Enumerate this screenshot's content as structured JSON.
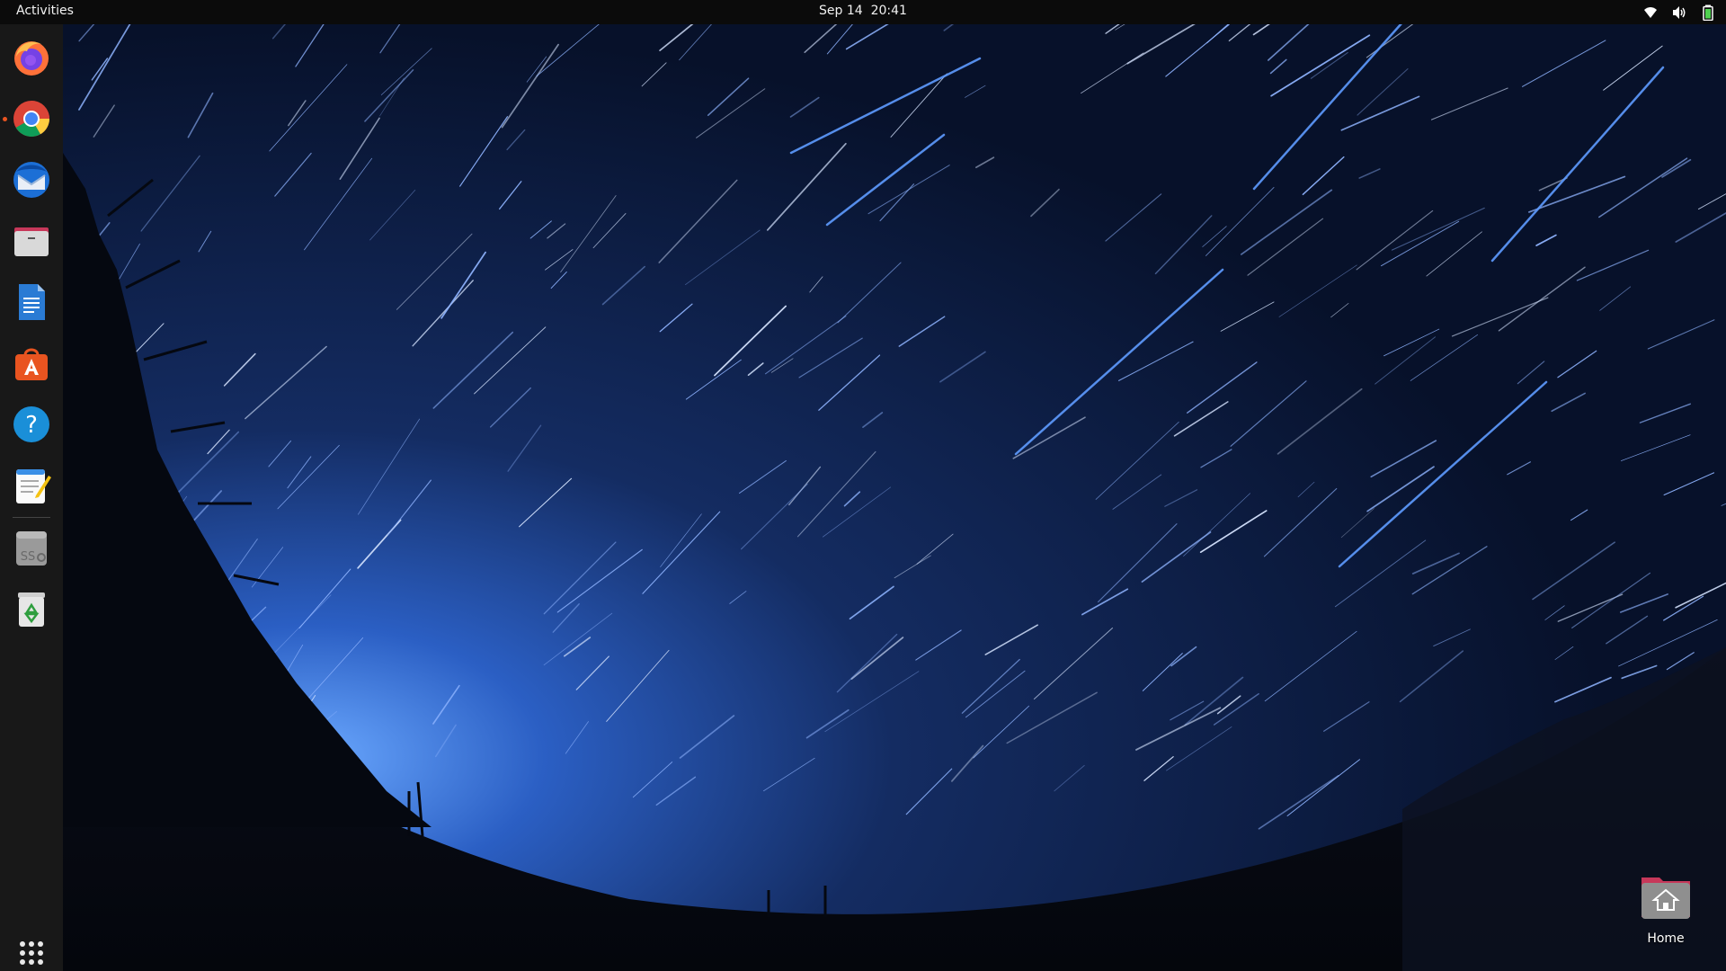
{
  "topbar": {
    "activities_label": "Activities",
    "date": "Sep 14",
    "time": "20:41",
    "tray": [
      "wifi-icon",
      "volume-icon",
      "battery-icon"
    ]
  },
  "dock": {
    "items": [
      {
        "name": "firefox",
        "icon": "firefox-icon",
        "running": false
      },
      {
        "name": "chrome",
        "icon": "chrome-icon",
        "running": true
      },
      {
        "name": "thunderbird",
        "icon": "thunderbird-icon",
        "running": false
      },
      {
        "name": "files",
        "icon": "files-icon",
        "running": false
      },
      {
        "name": "libreoffice-writer",
        "icon": "writer-icon",
        "running": false
      },
      {
        "name": "app-center",
        "icon": "app-center-icon",
        "running": false
      },
      {
        "name": "help",
        "icon": "help-icon",
        "running": false
      },
      {
        "name": "text-editor",
        "icon": "text-editor-icon",
        "running": false
      },
      {
        "name": "ssd",
        "icon": "ssd-icon",
        "running": false
      },
      {
        "name": "trash",
        "icon": "trash-icon",
        "running": false
      }
    ],
    "app_grid_icon": "app-grid-icon"
  },
  "desktop": {
    "home_label": "Home",
    "home_icon": "home-folder-icon"
  },
  "colors": {
    "accent": "#e95420",
    "sky_top": "#081225",
    "sky_glow": "#2f6fd6"
  }
}
